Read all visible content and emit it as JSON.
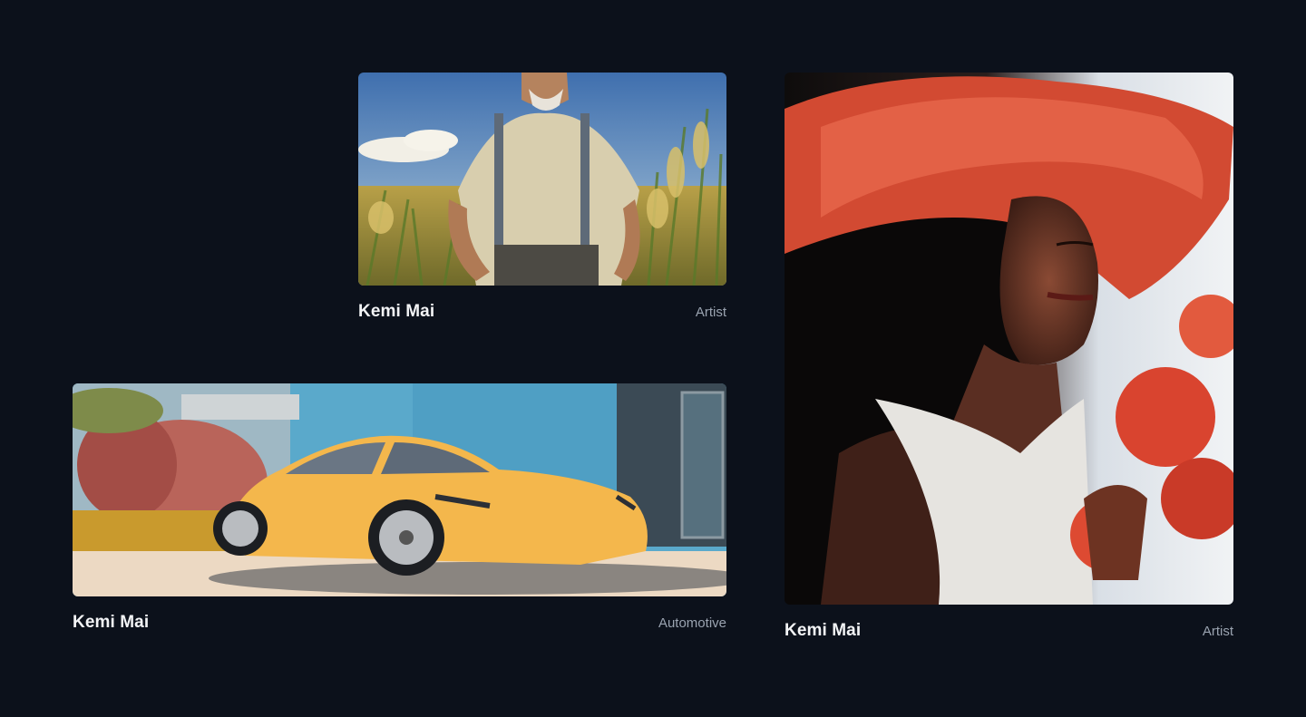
{
  "gallery": {
    "items": [
      {
        "title": "Kemi Mai",
        "category": "Artist",
        "image": "farmer-in-cornfield-illustration"
      },
      {
        "title": "Kemi Mai",
        "category": "Automotive",
        "image": "yellow-sports-car-illustration"
      },
      {
        "title": "Kemi Mai",
        "category": "Artist",
        "image": "woman-red-hat-roses-illustration"
      }
    ]
  },
  "colors": {
    "background": "#0c111b",
    "title_text": "#f3f4f6",
    "category_text": "#9aa3b0"
  }
}
